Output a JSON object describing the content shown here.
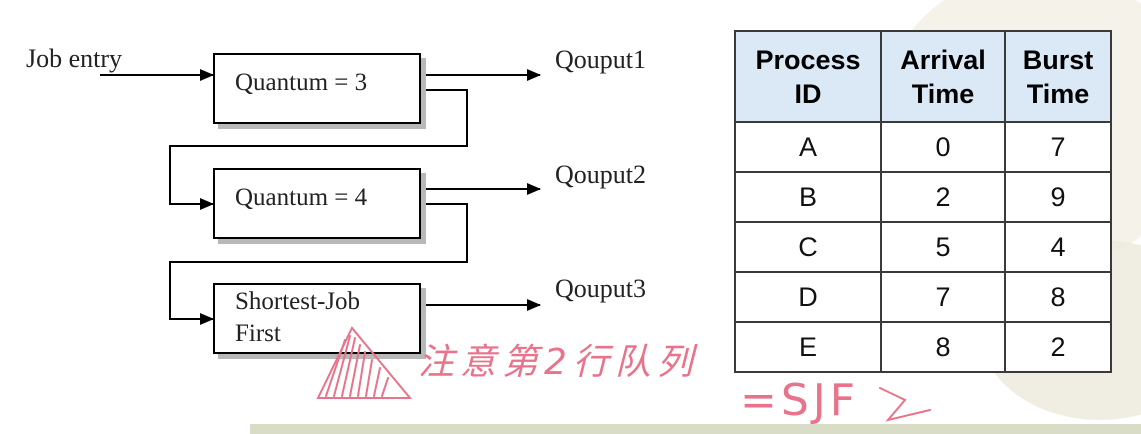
{
  "diagram": {
    "entry_label": "Job entry",
    "queues": [
      {
        "label": "Quantum = 3",
        "output": "Qouput1"
      },
      {
        "label": "Quantum = 4",
        "output": "Qouput2"
      },
      {
        "label_line1": "Shortest-Job",
        "label_line2": "First",
        "output": "Qouput3"
      }
    ]
  },
  "table": {
    "headers": {
      "process_id_1": "Process",
      "process_id_2": "ID",
      "arrival_1": "Arrival",
      "arrival_2": "Time",
      "burst_1": "Burst",
      "burst_2": "Time"
    },
    "rows": [
      {
        "id": "A",
        "arrival": "0",
        "burst": "7"
      },
      {
        "id": "B",
        "arrival": "2",
        "burst": "9"
      },
      {
        "id": "C",
        "arrival": "5",
        "burst": "4"
      },
      {
        "id": "D",
        "arrival": "7",
        "burst": "8"
      },
      {
        "id": "E",
        "arrival": "8",
        "burst": "2"
      }
    ]
  },
  "annotation": {
    "note": "注意第2行队列",
    "result": "=SJF"
  },
  "colors": {
    "annotation_ink": "#e8738a",
    "table_header_bg": "#dbe9f7"
  }
}
